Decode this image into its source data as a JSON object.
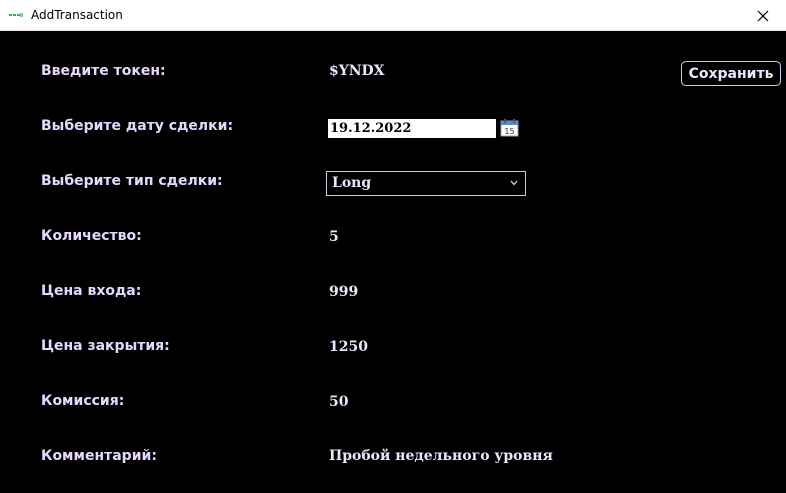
{
  "window": {
    "title": "AddTransaction",
    "close_glyph": "✕"
  },
  "form": {
    "token": {
      "label": "Введите токен:",
      "value": "$YNDX"
    },
    "date": {
      "label": "Выберите дату сделки:",
      "value": "19.12.2022",
      "calendar_icon": "calendar-icon",
      "calendar_day": "15"
    },
    "type": {
      "label": "Выберите тип сделки:",
      "value": "Long"
    },
    "quantity": {
      "label": "Количество:",
      "value": "5"
    },
    "entry_price": {
      "label": "Цена входа:",
      "value": "999"
    },
    "close_price": {
      "label": "Цена закрытия:",
      "value": "1250"
    },
    "commission": {
      "label": "Комиссия:",
      "value": "50"
    },
    "comment": {
      "label": "Комментарий:",
      "value": "Пробой недельного уровня"
    }
  },
  "toolbar": {
    "save_label": "Сохранить"
  },
  "colors": {
    "background": "#000000",
    "label_text": "#e6d7ff",
    "titlebar": "#ffffff",
    "app_icon_accent": "#3cb043"
  }
}
